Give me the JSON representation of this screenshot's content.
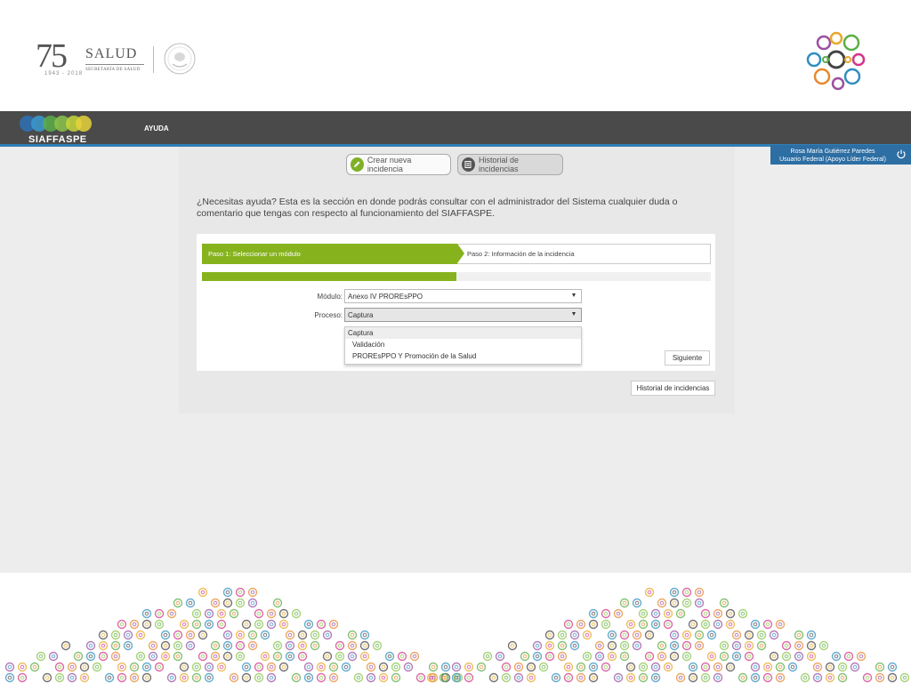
{
  "header": {
    "logo_75": "75",
    "logo_75_sub": "1943 - 2018",
    "logo_salud": "SALUD",
    "logo_salud_sub": "SECRETARÍA DE SALUD"
  },
  "navbar": {
    "brand": "SIAFFASPE",
    "menu_ayuda": "AYUDA"
  },
  "user": {
    "name": "Rosa María Gutiérrez Paredes",
    "role": "Usuario Federal (Apoyo Líder Federal)"
  },
  "tabs": {
    "new_incident": "Crear nueva incidencia",
    "history": "Historial de incidencias"
  },
  "help_text": "¿Necesitas ayuda? Esta es la sección en donde podrás consultar con el administrador del Sistema cualquier duda o comentario que tengas con respecto al funcionamiento del SIAFFASPE.",
  "wizard": {
    "step1": "Paso 1: Seleccionar un módulo",
    "step2": "Paso 2: Información de la incidencia",
    "progress_percent": 50
  },
  "form": {
    "modulo_label": "Módulo:",
    "modulo_value": "Anexo IV PROREsPPO",
    "proceso_label": "Proceso:",
    "proceso_value": "Captura",
    "proceso_options": [
      "Captura",
      "Validación",
      "PROREsPPO Y Promoción de la Salud"
    ]
  },
  "buttons": {
    "siguiente": "Siguiente",
    "historial": "Historial de incidencias"
  },
  "colors": {
    "accent_green": "#86b31d",
    "nav_dark": "#4a4a4a",
    "user_blue": "#2d6ea3"
  }
}
